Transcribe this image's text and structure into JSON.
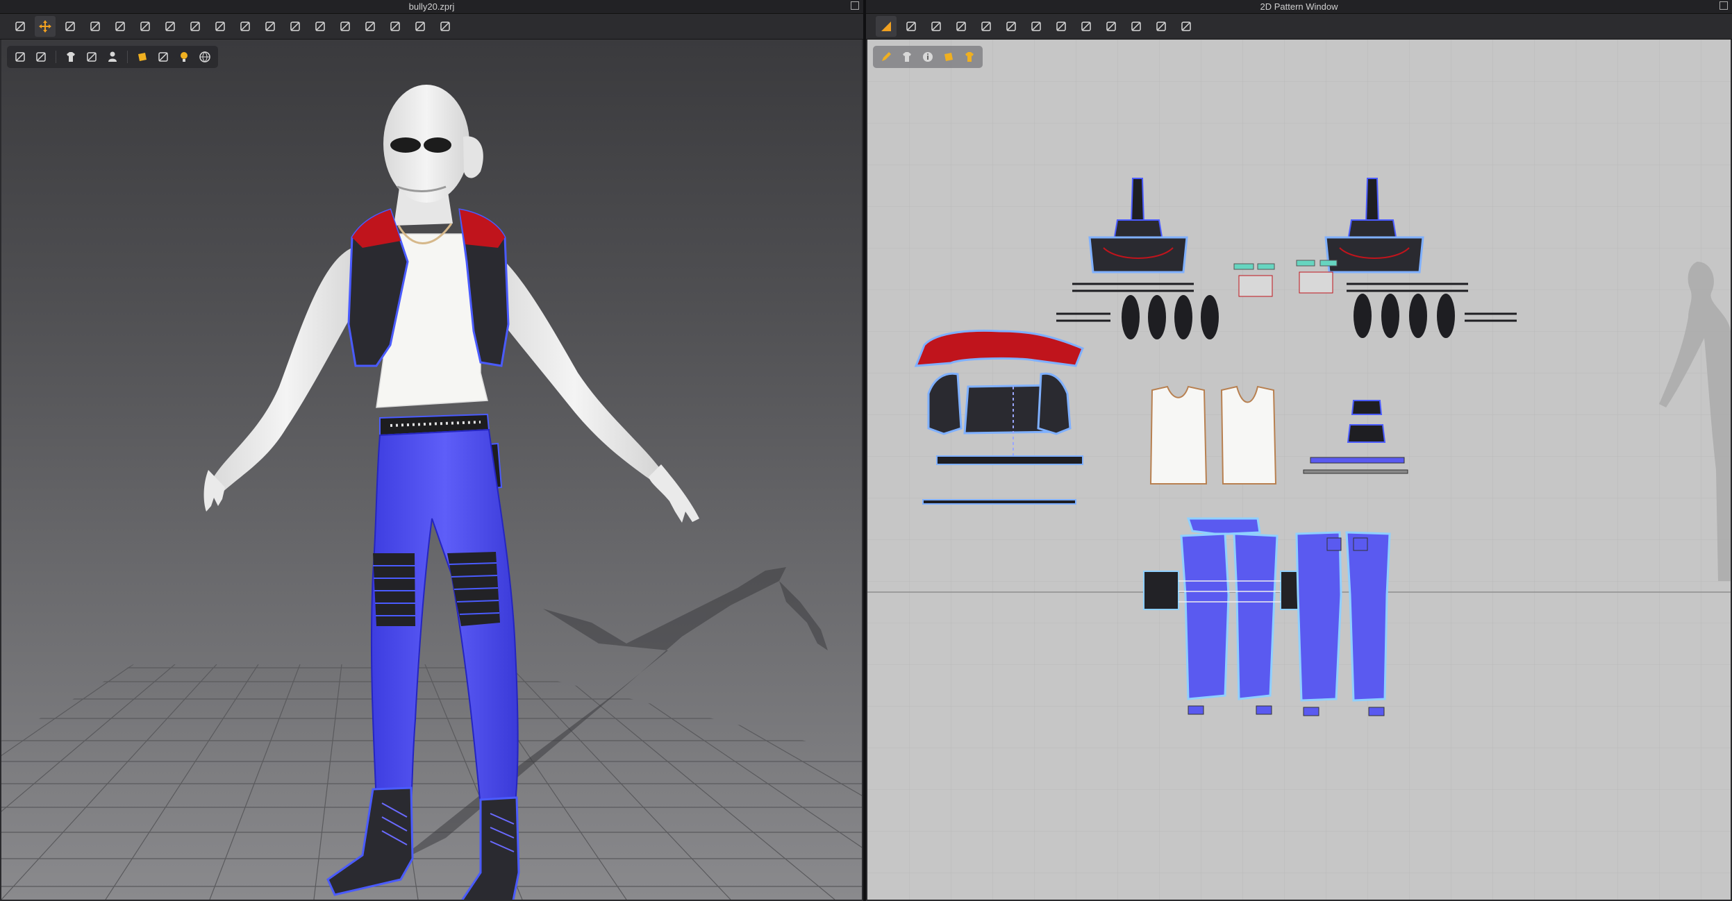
{
  "window_3d": {
    "title": "bully20.zprj"
  },
  "window_2d": {
    "title": "2D Pattern Window"
  },
  "toolbar_3d": {
    "buttons": [
      {
        "icon": "select-mesh-icon",
        "active": false
      },
      {
        "icon": "transform-move-icon",
        "active": true
      },
      {
        "icon": "edit-pattern-icon",
        "active": false
      },
      {
        "icon": "brush-icon",
        "active": false
      },
      {
        "icon": "tack-icon",
        "active": false
      },
      {
        "icon": "pin-icon",
        "active": false
      },
      {
        "icon": "measure-icon",
        "active": false
      },
      {
        "icon": "fold-icon",
        "active": false
      },
      {
        "icon": "arrangement-icon",
        "active": false
      },
      {
        "icon": "gather-icon",
        "active": false
      },
      {
        "icon": "grid-icon",
        "active": false
      },
      {
        "icon": "strengthen-icon",
        "active": false
      },
      {
        "icon": "pleat-icon",
        "active": false
      },
      {
        "icon": "button-icon",
        "active": false
      },
      {
        "icon": "topstitch-icon",
        "active": false
      },
      {
        "icon": "zipper-icon",
        "active": false
      },
      {
        "icon": "puckering-icon",
        "active": false
      },
      {
        "icon": "avatar-pose-icon",
        "active": false
      }
    ],
    "mini_groups": [
      [
        "texture-surface-icon",
        "thick-surface-icon"
      ],
      [
        "garment-icon",
        "avatar-garment-icon",
        "avatar-icon"
      ],
      [
        "pin-visibility-icon",
        "wireframe-icon",
        "light-icon",
        "globe-icon"
      ]
    ]
  },
  "toolbar_2d": {
    "buttons": [
      {
        "icon": "transform-pattern-icon",
        "active": true
      },
      {
        "icon": "edit-curvature-icon",
        "active": false
      },
      {
        "icon": "rectangle-icon",
        "active": false
      },
      {
        "icon": "internal-shape-icon",
        "active": false
      },
      {
        "icon": "trace-icon",
        "active": false
      },
      {
        "icon": "offset-icon",
        "active": false
      },
      {
        "icon": "grid-pattern-icon",
        "active": false
      },
      {
        "icon": "fold-pattern-icon",
        "active": false
      },
      {
        "icon": "shirt-pattern-icon",
        "active": false
      },
      {
        "icon": "segment-sewing-icon",
        "active": false
      },
      {
        "icon": "free-sewing-icon",
        "active": false
      },
      {
        "icon": "stitch-icon",
        "active": false
      },
      {
        "icon": "ruler-icon",
        "active": false
      }
    ],
    "mini_tools": [
      "pencil-icon",
      "shirt-icon",
      "info-icon",
      "highlight-icon",
      "shirt-color-icon"
    ]
  },
  "colors": {
    "jeans": "#5a5af0",
    "vest_red": "#c0141c",
    "vest_dark": "#2a2a2e",
    "outline": "#4a5bff",
    "skin": "#ececec",
    "shirt": "#f7f7f5"
  }
}
